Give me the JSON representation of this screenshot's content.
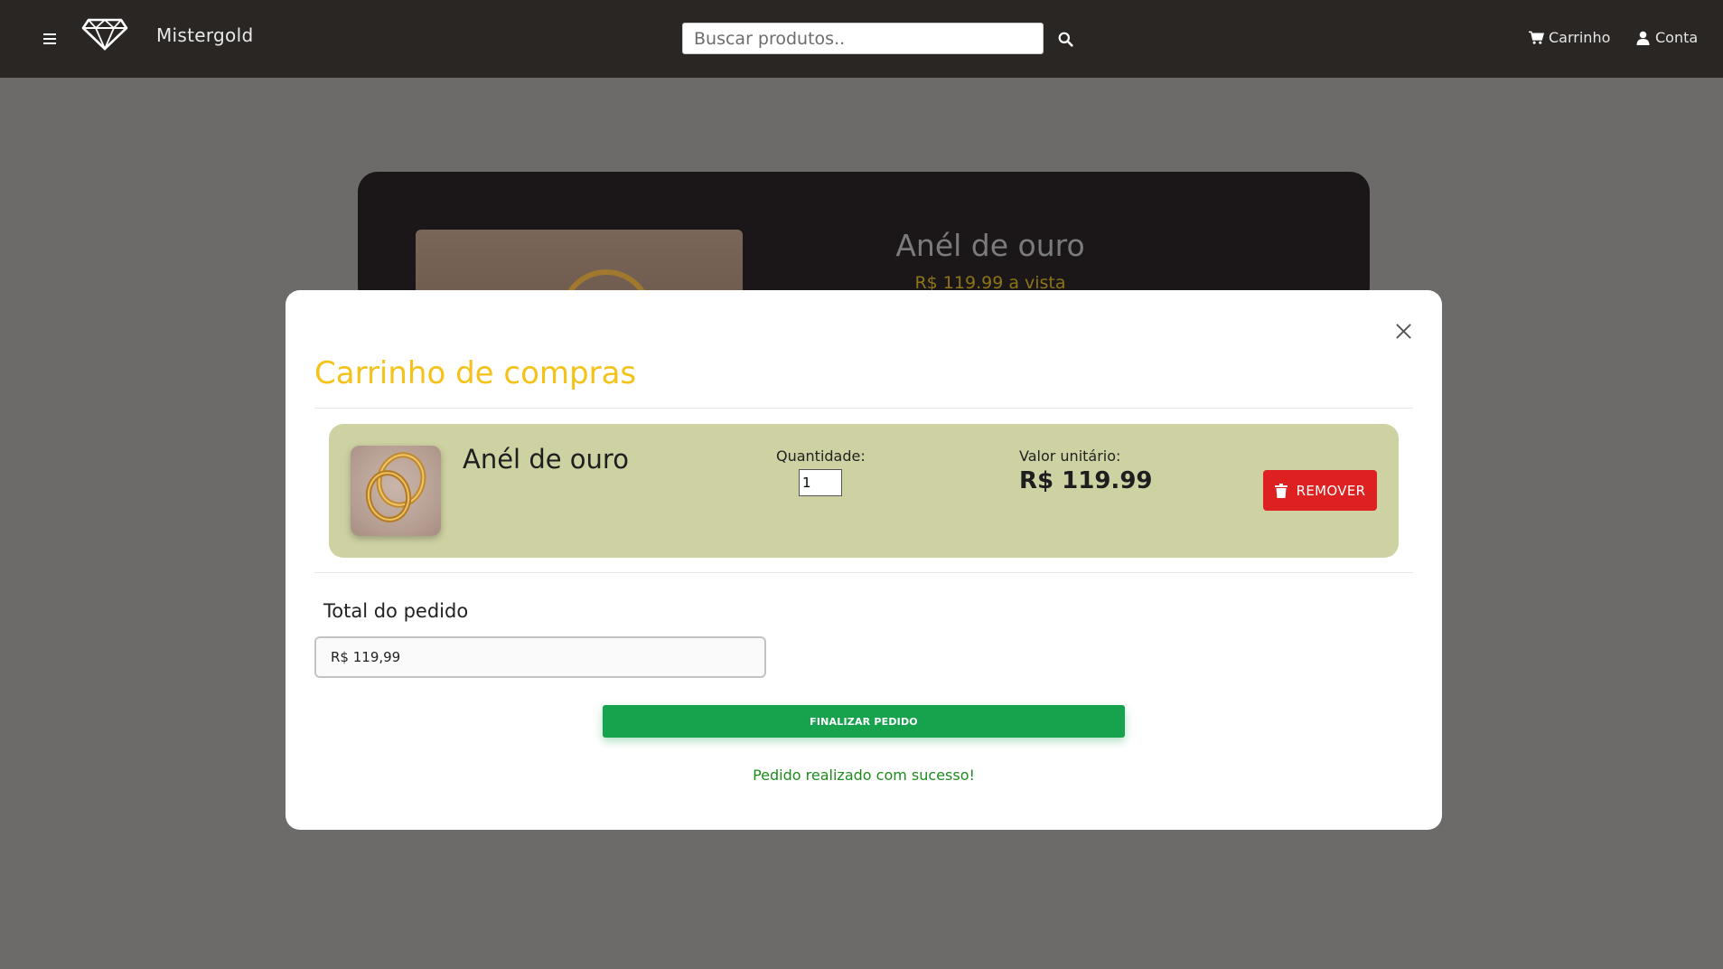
{
  "navbar": {
    "brand": "Mistergold",
    "search_placeholder": "Buscar produtos..",
    "cart_label": "Carrinho",
    "account_label": "Conta",
    "icons": [
      "menu-icon",
      "diamond-logo-icon",
      "search-icon",
      "cart-icon",
      "user-icon"
    ]
  },
  "product_card": {
    "title": "Anél de ouro",
    "price": "R$ 119.99 a vista"
  },
  "modal": {
    "title": "Carrinho de compras",
    "item": {
      "name": "Anél de ouro",
      "quantity_label": "Quantidade:",
      "quantity": "1",
      "unit_price_label": "Valor unitário:",
      "unit_price": "R$ 119.99",
      "remove_label": "REMOVER"
    },
    "total_label": "Total do pedido",
    "total_value": "R$ 119,99",
    "finalize_label": "FINALIZAR PEDIDO",
    "success_message": "Pedido realizado com sucesso!"
  },
  "colors": {
    "navbar_bg": "#2a2624",
    "overlay_bg": "#6c6b69",
    "title_accent": "#f5c21a",
    "item_bg": "#ced2a2",
    "remove_red": "#dd2121",
    "finalize_green": "#17a24e",
    "success_green": "#1e8a1e"
  }
}
